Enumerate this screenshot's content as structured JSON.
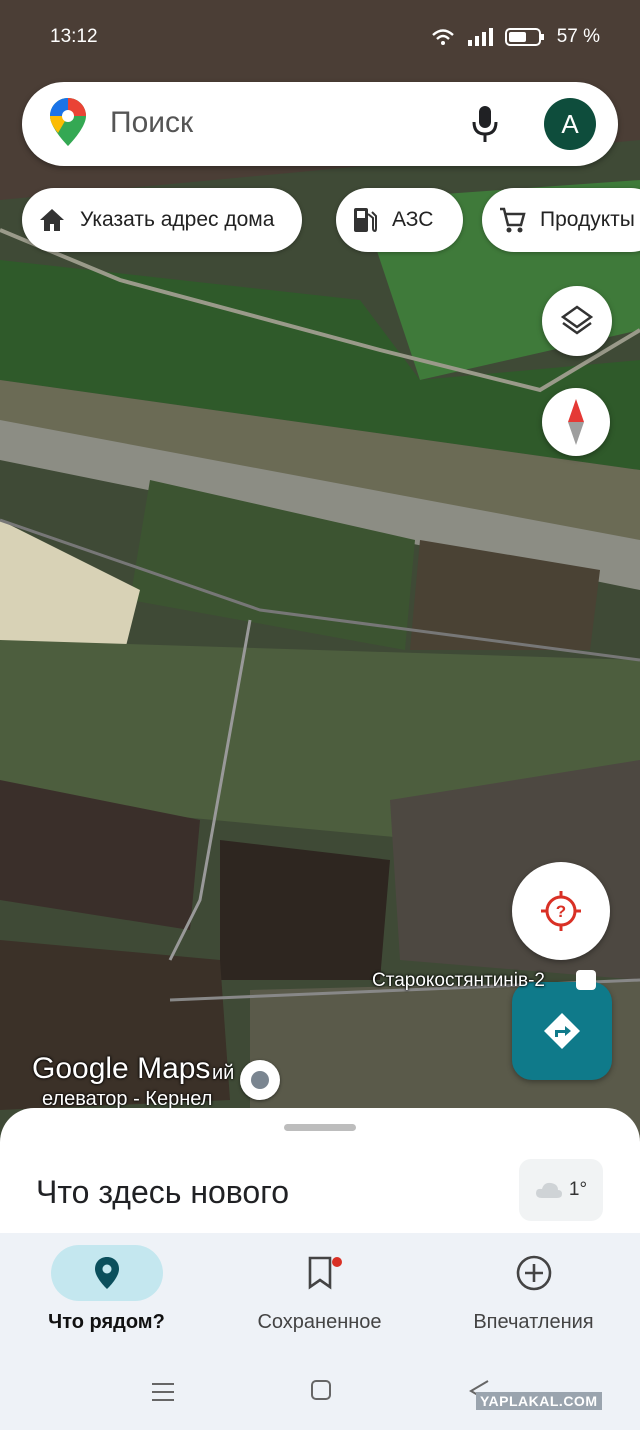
{
  "status_bar": {
    "time": "13:12",
    "battery": "57 %"
  },
  "search": {
    "placeholder": "Поиск",
    "avatar_letter": "A"
  },
  "chips": [
    {
      "label": "Указать адрес дома",
      "icon": "home-icon"
    },
    {
      "label": "АЗС",
      "icon": "gas-station-icon"
    },
    {
      "label": "Продукты",
      "icon": "cart-icon"
    }
  ],
  "map": {
    "place_label": "Старокостянтинів-2",
    "poi_label": "елеватор - Кернел",
    "poi_label_partial": "ий",
    "watermark": "Google Maps"
  },
  "sheet": {
    "title": "Что здесь нового",
    "weather": "1°"
  },
  "bottom_nav": [
    {
      "label": "Что рядом?",
      "icon": "pin-icon",
      "active": true
    },
    {
      "label": "Сохраненное",
      "icon": "bookmark-icon",
      "active": false
    },
    {
      "label": "Впечатления",
      "icon": "add-circle-icon",
      "active": false
    }
  ],
  "site_watermark": "YAPLAKAL.COM",
  "colors": {
    "accent_teal": "#0f7a8a",
    "avatar": "#0e4d3c",
    "alert_red": "#d93025"
  }
}
